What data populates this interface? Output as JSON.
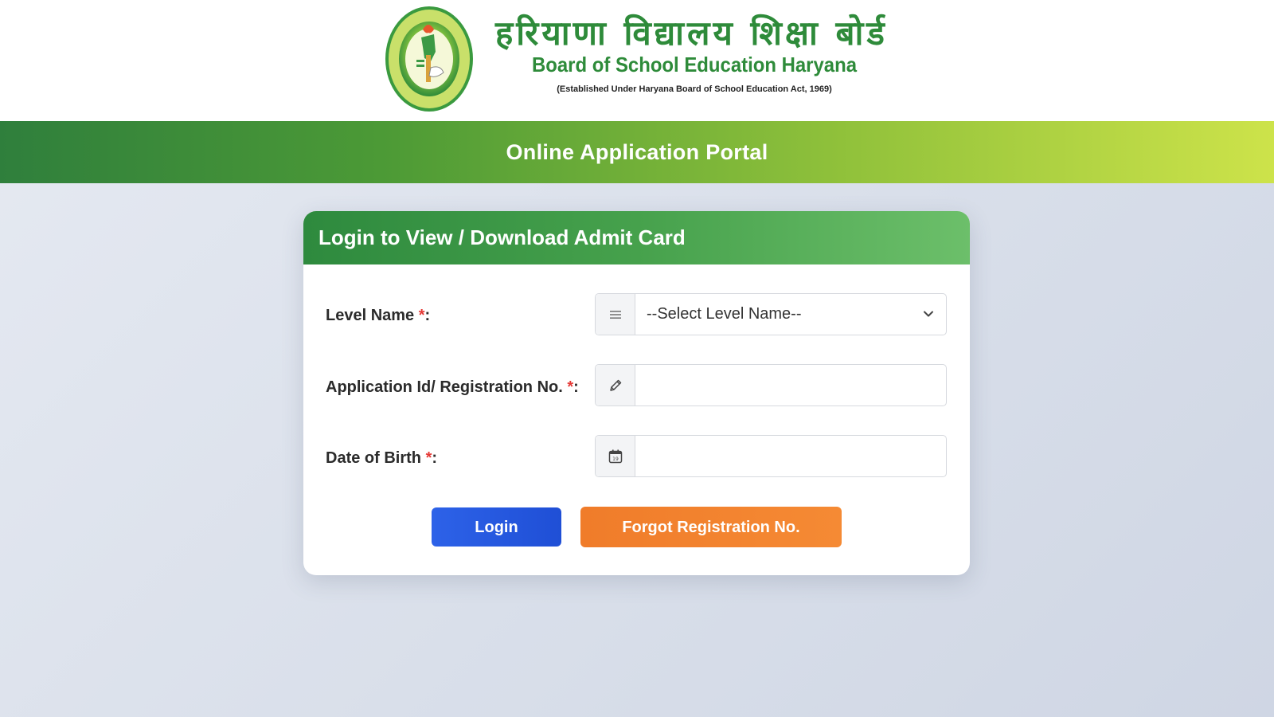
{
  "header": {
    "title_hindi": "हरियाणा विद्यालय शिक्षा बोर्ड",
    "title_english": "Board of School Education Haryana",
    "subtitle": "(Established Under Haryana Board of School Education Act, 1969)",
    "logo_icon": "bseh-emblem-icon"
  },
  "banner": {
    "title": "Online Application Portal"
  },
  "form": {
    "title": "Login to View / Download Admit Card",
    "required_mark": "*",
    "level": {
      "label": "Level Name ",
      "suffix": ":",
      "selected": "--Select Level Name--",
      "icon": "list-icon"
    },
    "application": {
      "label": "Application Id/ Registration No. ",
      "suffix": ":",
      "value": "",
      "placeholder": "",
      "icon": "pencil-icon"
    },
    "dob": {
      "label": "Date of Birth ",
      "suffix": ":",
      "value": "",
      "placeholder": "",
      "icon": "calendar-icon",
      "icon_day": "19"
    },
    "login_label": "Login",
    "forgot_label": "Forgot Registration No."
  },
  "colors": {
    "brand_green": "#2e8b3a",
    "login_blue": "#1f4fd6",
    "forgot_orange": "#f58a34",
    "required_red": "#e53935"
  }
}
